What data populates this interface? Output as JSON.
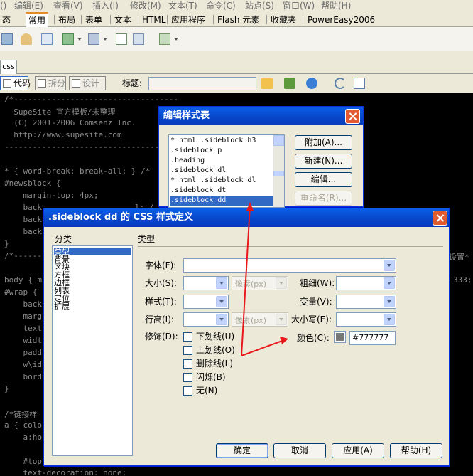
{
  "menu": [
    "编辑(E)",
    "查看(V)",
    "插入(I)",
    "修改(M)",
    "文本(T)",
    "命令(C)",
    "站点(S)",
    "窗口(W)",
    "帮助(H)"
  ],
  "menu_stub": "态",
  "insert_tabs": [
    "常用",
    "布局",
    "表单",
    "文本",
    "HTML",
    "应用程序",
    "Flash 元素",
    "收藏夹",
    "PowerEasy2006"
  ],
  "doc_tab": "css",
  "view_buttons": {
    "code": "代码",
    "split": "拆分",
    "design": "设计"
  },
  "title_label": "标题:",
  "title_value": "",
  "code_lines": [
    "/*-----------------------------------",
    "  SupeSite 官方模板/未整理",
    "  (C) 2001-2006 Comsenz Inc.",
    "  http://www.supesite.com",
    "---------------------------------",
    "* { word-break: break-all; } /*",
    "#newsblock {",
    "    margin-top: 4px;",
    "    back",
    "    back",
    "    back",
    "}",
    "/*-------",
    "body { m",
    "#wrap {",
    "    back",
    "    marg",
    "    text",
    "    widt",
    "    padd",
    "    w\\id",
    "    bord",
    "}",
    "/*链接样",
    "a { colo",
    "    a:ho",
    "",
    "    #top",
    "    text-decoration: none;"
  ],
  "code_right": {
    "r1": "设置*",
    "r2": "333;"
  },
  "code_fragments": {
    "f1": "l; /",
    "f2": "/"
  },
  "edit_dialog": {
    "title": "编辑样式表",
    "items": [
      "* html .sideblock h3",
      ".sideblock p",
      ".heading",
      ".sideblock dl",
      "* html .sideblock dl",
      ".sideblock dt",
      ".sideblock dd"
    ],
    "selected_index": 6,
    "buttons": {
      "attach": "附加(A)...",
      "new": "新建(N)...",
      "edit": "编辑...",
      "rename": "重命名(R)..."
    }
  },
  "css_dialog": {
    "title": ".sideblock dd 的 CSS 样式定义",
    "category_header": "分类",
    "categories": [
      "类型",
      "背景",
      "区块",
      "方框",
      "边框",
      "列表",
      "定位",
      "扩展"
    ],
    "selected_category": 0,
    "panel_title": "类型",
    "labels": {
      "font": "字体(F):",
      "size": "大小(S):",
      "weight": "粗细(W):",
      "style": "样式(T):",
      "variant": "变量(V):",
      "line_height": "行高(I):",
      "case": "大小写(E):",
      "decoration": "修饰(D):",
      "color": "颜色(C):"
    },
    "unit_placeholder": "像素(px)",
    "decorations": [
      "下划线(U)",
      "上划线(O)",
      "删除线(L)",
      "闪烁(B)",
      "无(N)"
    ],
    "color_value": "#777777",
    "swatch_color": "#777777",
    "buttons": {
      "ok": "确定",
      "cancel": "取消",
      "apply": "应用(A)",
      "help": "帮助(H)"
    }
  },
  "annotation_color": "#e8191b"
}
